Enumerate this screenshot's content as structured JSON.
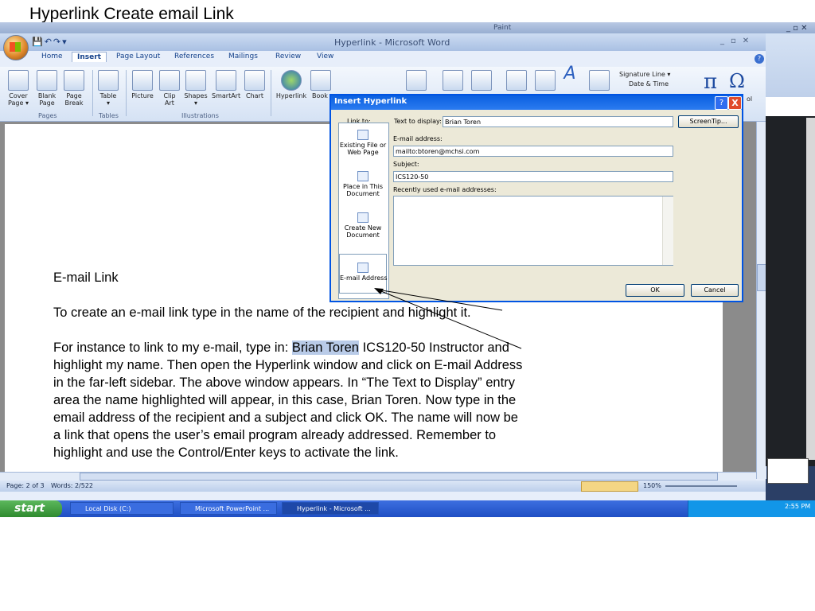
{
  "slide": {
    "title": "Hyperlink Create email Link",
    "heading": "E-mail Link",
    "para1": "To create an e-mail link type in the name of the recipient and highlight it.",
    "para2_prefix": "For instance to link to my e-mail, type in:",
    "para2_highlight": "Brian Toren",
    "para2_rest": "ICS120-50 Instructor and",
    "lines": [
      "highlight my name. Then open the Hyperlink window and click on E-mail Address",
      "in the far-left sidebar. The above window appears. In “The Text to Display” entry",
      "area the name highlighted will appear, in this case, Brian Toren. Now type in  the",
      "email address of the recipient and a subject and click OK. The name will now be",
      "a link that opens the user’s email program already addressed. Remember to",
      "highlight and use the Control/Enter keys to activate the link."
    ]
  },
  "word": {
    "window_title": "Hyperlink - Microsoft Word",
    "tabs": [
      "Home",
      "Insert",
      "Page Layout",
      "References",
      "Mailings",
      "Review",
      "View"
    ],
    "active_tab": "Insert",
    "ribbon_buttons": [
      {
        "label": "Cover\nPage ▾",
        "icon": "cover-page-icon"
      },
      {
        "label": "Blank\nPage",
        "icon": "blank-page-icon"
      },
      {
        "label": "Page\nBreak",
        "icon": "page-break-icon"
      },
      {
        "label": "Table\n▾",
        "icon": "table-icon"
      },
      {
        "label": "Picture",
        "icon": "picture-icon"
      },
      {
        "label": "Clip\nArt",
        "icon": "clip-art-icon"
      },
      {
        "label": "Shapes\n▾",
        "icon": "shapes-icon"
      },
      {
        "label": "SmartArt",
        "icon": "smartart-icon"
      },
      {
        "label": "Chart",
        "icon": "chart-icon"
      },
      {
        "label": "Hyperlink",
        "icon": "hyperlink-icon"
      },
      {
        "label": "Book",
        "icon": "bookmark-icon"
      }
    ],
    "groups": [
      "Pages",
      "Tables",
      "Illustrations"
    ],
    "signature_line": "Signature Line ▾",
    "date_time": "Date & Time",
    "symbol_label": "ol",
    "status": {
      "page": "Page: 2 of 3",
      "words": "Words: 2/522",
      "zoom": "150%"
    },
    "help": "?"
  },
  "dialog": {
    "title": "Insert Hyperlink",
    "link_to_label": "Link to:",
    "text_to_display_label": "Text to display:",
    "text_to_display_value": "Brian Toren",
    "screentip_label": "ScreenTip...",
    "email_label": "E-mail address:",
    "email_value": "mailto:btoren@mchsi.com",
    "subject_label": "Subject:",
    "subject_value": "ICS120-50",
    "recent_label": "Recently used e-mail addresses:",
    "ok_label": "OK",
    "cancel_label": "Cancel",
    "help_label": "?",
    "close_label": "X",
    "link_targets": [
      {
        "label": "Existing File or\nWeb Page",
        "icon": "existing-file-icon"
      },
      {
        "label": "Place in This\nDocument",
        "icon": "place-in-document-icon"
      },
      {
        "label": "Create New\nDocument",
        "icon": "new-document-icon"
      },
      {
        "label": "E-mail Address",
        "icon": "email-address-icon"
      }
    ],
    "selected_target": "E-mail Address"
  },
  "taskbar": {
    "start_label": "start",
    "tasks": [
      "Local Disk (C:)",
      "Microsoft PowerPoint ...",
      "Hyperlink - Microsoft ..."
    ],
    "clock": "2:55 PM"
  },
  "background_window": {
    "title_fragment": "Paint"
  },
  "colors": {
    "dialog_border": "#0054e3",
    "selection": "#b9cbe8",
    "taskbar": "#245edb"
  }
}
